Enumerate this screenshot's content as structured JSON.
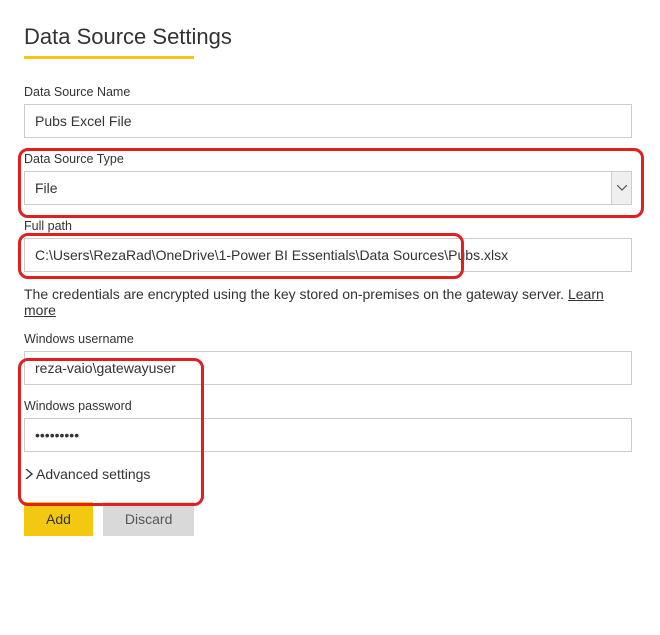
{
  "header": {
    "title": "Data Source Settings"
  },
  "fields": {
    "name": {
      "label": "Data Source Name",
      "value": "Pubs Excel File"
    },
    "type": {
      "label": "Data Source Type",
      "value": "File"
    },
    "path": {
      "label": "Full path",
      "value": "C:\\Users\\RezaRad\\OneDrive\\1-Power BI Essentials\\Data Sources\\Pubs.xlsx"
    },
    "username": {
      "label": "Windows username",
      "value": "reza-vaio\\gatewayuser"
    },
    "password": {
      "label": "Windows password",
      "value": "•••••••••"
    }
  },
  "credentials_note": "The credentials are encrypted using the key stored on-premises on the gateway server. ",
  "learn_more": "Learn more",
  "advanced": {
    "label": "Advanced settings"
  },
  "buttons": {
    "add": "Add",
    "discard": "Discard"
  }
}
